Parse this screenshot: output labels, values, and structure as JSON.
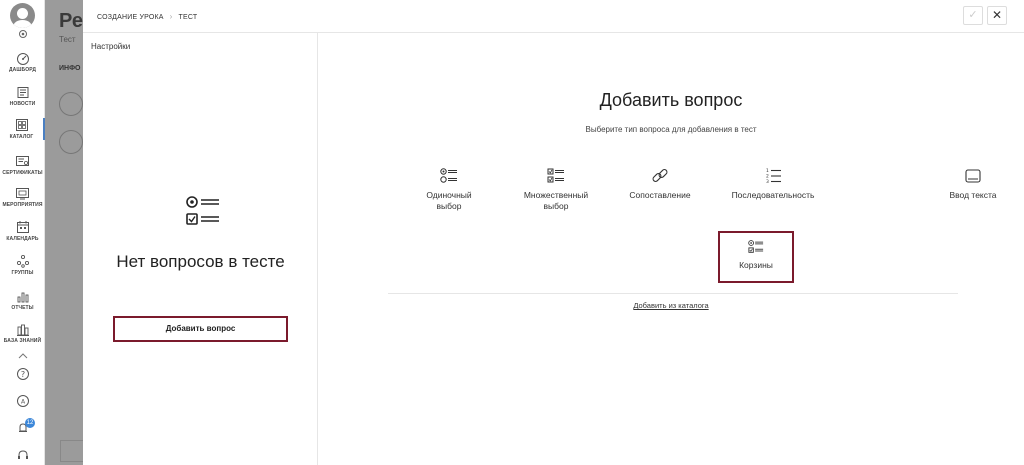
{
  "nav": {
    "items": [
      {
        "label": "ДАШБОРД",
        "icon": "dashboard-icon"
      },
      {
        "label": "НОВОСТИ",
        "icon": "news-icon"
      },
      {
        "label": "КАТАЛОГ",
        "icon": "catalog-icon"
      },
      {
        "label": "СЕРТИФИКАТЫ",
        "icon": "certificate-icon"
      },
      {
        "label": "МЕРОПРИЯТИЯ",
        "icon": "events-icon"
      },
      {
        "label": "КАЛЕНДАРЬ",
        "icon": "calendar-icon"
      },
      {
        "label": "ГРУППЫ",
        "icon": "groups-icon"
      },
      {
        "label": "ОТЧЕТЫ",
        "icon": "reports-icon"
      },
      {
        "label": "БАЗА ЗНАНИЙ",
        "icon": "knowledge-base-icon"
      }
    ],
    "notifications_count": "12"
  },
  "background": {
    "title": "Ре",
    "subtitle": "Тест",
    "tab": "ИНФО"
  },
  "breadcrumb": {
    "parent": "СОЗДАНИЕ УРОКА",
    "current": "ТЕСТ"
  },
  "sidebar": {
    "settings_label": "Настройки",
    "empty_title": "Нет вопросов в тесте",
    "add_button": "Добавить вопрос"
  },
  "main": {
    "title": "Добавить вопрос",
    "subtitle": "Выберите тип вопроса для добавления в тест",
    "question_types": [
      {
        "label": "Одиночный выбор",
        "icon": "single-choice-icon"
      },
      {
        "label": "Множественный выбор",
        "icon": "multiple-choice-icon"
      },
      {
        "label": "Сопоставление",
        "icon": "link-icon"
      },
      {
        "label": "Последовательность",
        "icon": "ordered-list-icon"
      },
      {
        "label": "Ввод текста",
        "icon": "text-input-icon"
      },
      {
        "label": "Корзины",
        "icon": "baskets-icon"
      }
    ],
    "catalog_link": "Добавить из каталога"
  }
}
